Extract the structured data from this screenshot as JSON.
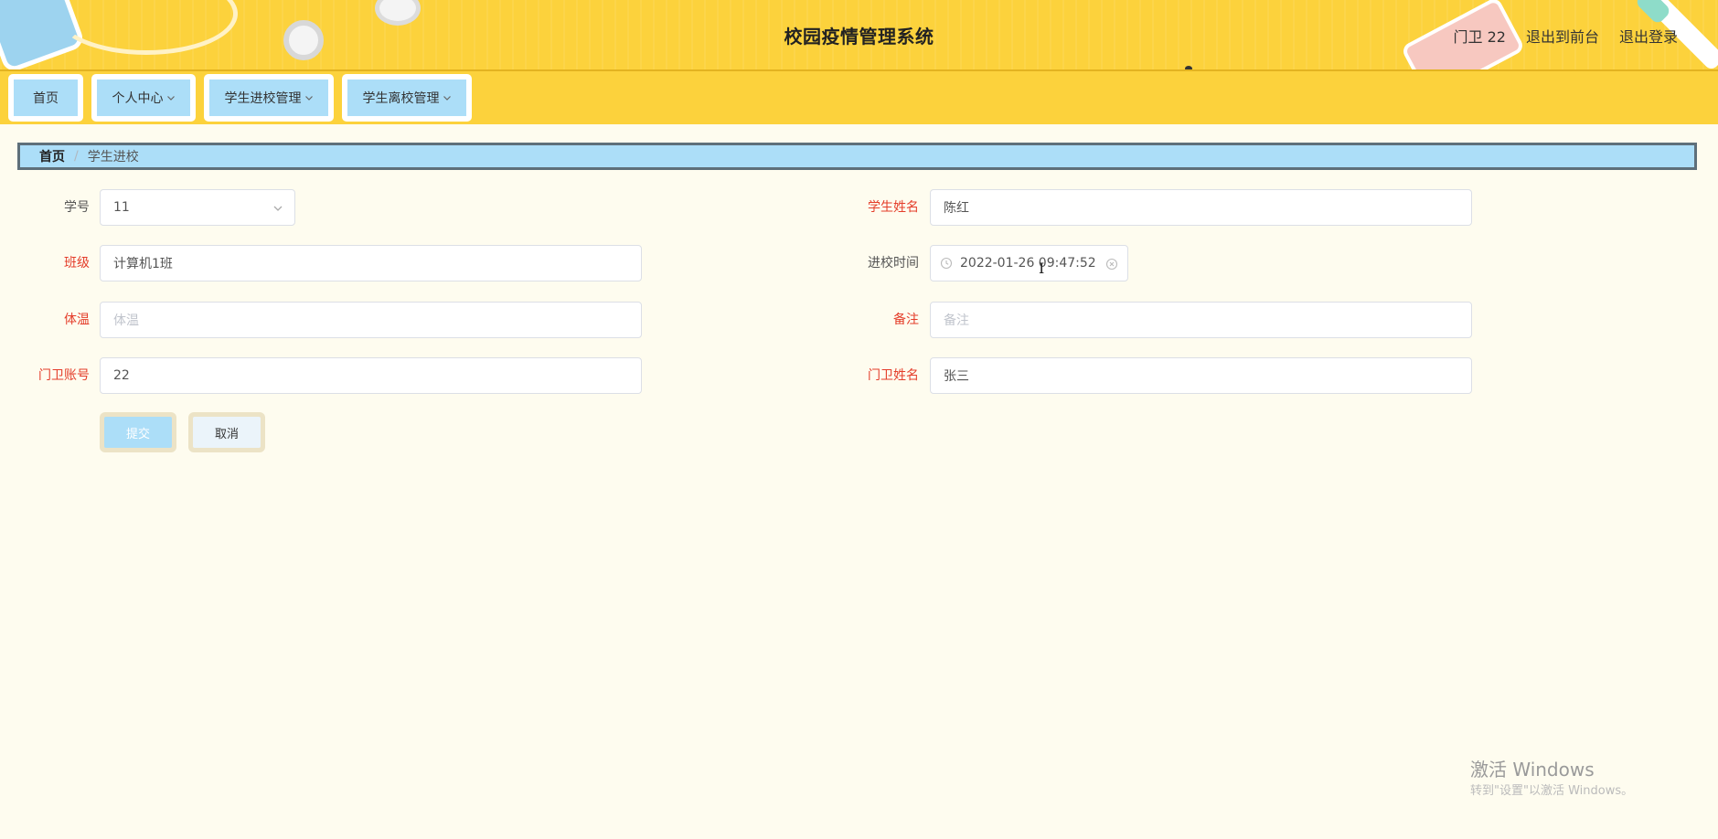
{
  "header": {
    "title": "校园疫情管理系统",
    "user_label": "门卫 22",
    "front_link": "退出到前台",
    "logout_link": "退出登录"
  },
  "nav": {
    "items": [
      {
        "label": "首页",
        "has_dropdown": false
      },
      {
        "label": "个人中心",
        "has_dropdown": true
      },
      {
        "label": "学生进校管理",
        "has_dropdown": true
      },
      {
        "label": "学生离校管理",
        "has_dropdown": true
      }
    ]
  },
  "breadcrumb": {
    "home": "首页",
    "separator": "/",
    "current": "学生进校"
  },
  "form": {
    "student_id": {
      "label": "学号",
      "value": "11"
    },
    "student_name": {
      "label": "学生姓名",
      "value": "陈红"
    },
    "class": {
      "label": "班级",
      "value": "计算机1班"
    },
    "entry_time": {
      "label": "进校时间",
      "value": "2022-01-26 09:47:52"
    },
    "temperature": {
      "label": "体温",
      "value": "",
      "placeholder": "体温"
    },
    "remark": {
      "label": "备注",
      "value": "",
      "placeholder": "备注"
    },
    "guard_account": {
      "label": "门卫账号",
      "value": "22"
    },
    "guard_name": {
      "label": "门卫姓名",
      "value": "张三"
    },
    "submit_label": "提交",
    "cancel_label": "取消"
  },
  "watermark": {
    "title": "激活 Windows",
    "subtitle": "转到\"设置\"以激活 Windows。"
  },
  "colors": {
    "header_bg": "#fcd23c",
    "nav_item_bg": "#acdef8",
    "page_bg": "#fefcef",
    "required_label": "#e43d2a"
  }
}
